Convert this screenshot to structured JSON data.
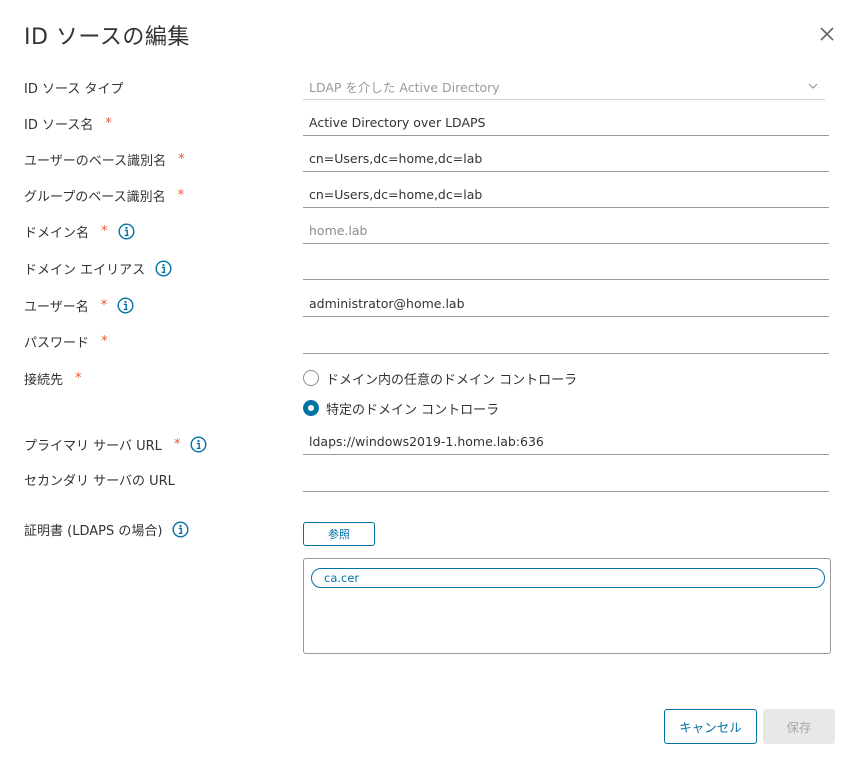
{
  "dialog": {
    "title": "ID ソースの編集",
    "close_icon": "close-icon"
  },
  "form": {
    "required_mark": "*",
    "source_type": {
      "label": "ID ソース タイプ",
      "value": "LDAP を介した Active Directory"
    },
    "source_name": {
      "label": "ID ソース名",
      "value": "Active Directory over LDAPS"
    },
    "user_base_dn": {
      "label": "ユーザーのベース識別名",
      "value": "cn=Users,dc=home,dc=lab"
    },
    "group_base_dn": {
      "label": "グループのベース識別名",
      "value": "cn=Users,dc=home,dc=lab"
    },
    "domain_name": {
      "label": "ドメイン名",
      "value": "",
      "placeholder": "home.lab"
    },
    "domain_alias": {
      "label": "ドメイン エイリアス",
      "value": ""
    },
    "username": {
      "label": "ユーザー名",
      "value": "administrator@home.lab"
    },
    "password": {
      "label": "パスワード",
      "value": ""
    },
    "connect_to": {
      "label": "接続先",
      "options": [
        {
          "label": "ドメイン内の任意のドメイン コントローラ",
          "selected": false
        },
        {
          "label": "特定のドメイン コントローラ",
          "selected": true
        }
      ]
    },
    "primary_url": {
      "label": "プライマリ サーバ URL",
      "value": "ldaps://windows2019-1.home.lab:636"
    },
    "secondary_url": {
      "label": "セカンダリ サーバの URL",
      "value": ""
    },
    "certificate": {
      "label": "証明書 (LDAPS の場合)",
      "browse_label": "参照",
      "files": [
        "ca.cer"
      ]
    }
  },
  "footer": {
    "cancel_label": "キャンセル",
    "save_label": "保存"
  },
  "colors": {
    "accent": "#0072a3",
    "required": "#e8592a",
    "text": "#333333",
    "disabled_bg": "#e8e8e8"
  },
  "icons": {
    "info": "info-icon",
    "dropdown": "chevron-down-icon",
    "close": "close-icon"
  }
}
